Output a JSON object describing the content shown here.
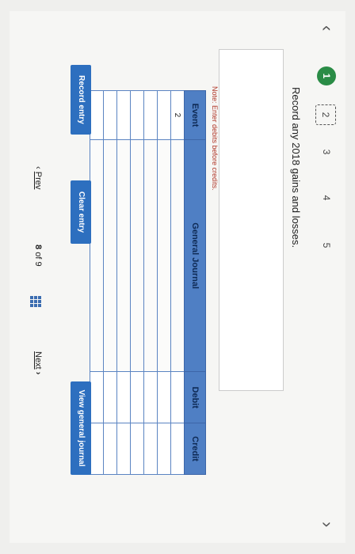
{
  "steps": [
    "1",
    "2",
    "3",
    "4",
    "5"
  ],
  "prompt": "Record any 2018 gains and losses.",
  "note": "Note: Enter debits before credits.",
  "journal": {
    "headers": {
      "event": "Event",
      "general_journal": "General Journal",
      "debit": "Debit",
      "credit": "Credit"
    },
    "event_value": "2"
  },
  "buttons": {
    "record": "Record entry",
    "clear": "Clear entry",
    "view": "View general journal"
  },
  "pagination": {
    "prev": "Prev",
    "page": "8",
    "of": "of",
    "total": "9",
    "next": "Next"
  },
  "icons": {
    "prev": "chevron-left-icon",
    "next": "chevron-right-icon",
    "grid": "grid-icon",
    "hand": "hand-pointer-icon"
  },
  "colors": {
    "step_active": "#2a8c46",
    "button": "#2d6fbf",
    "table_header": "#4f7fc4",
    "note": "#b0382a"
  }
}
